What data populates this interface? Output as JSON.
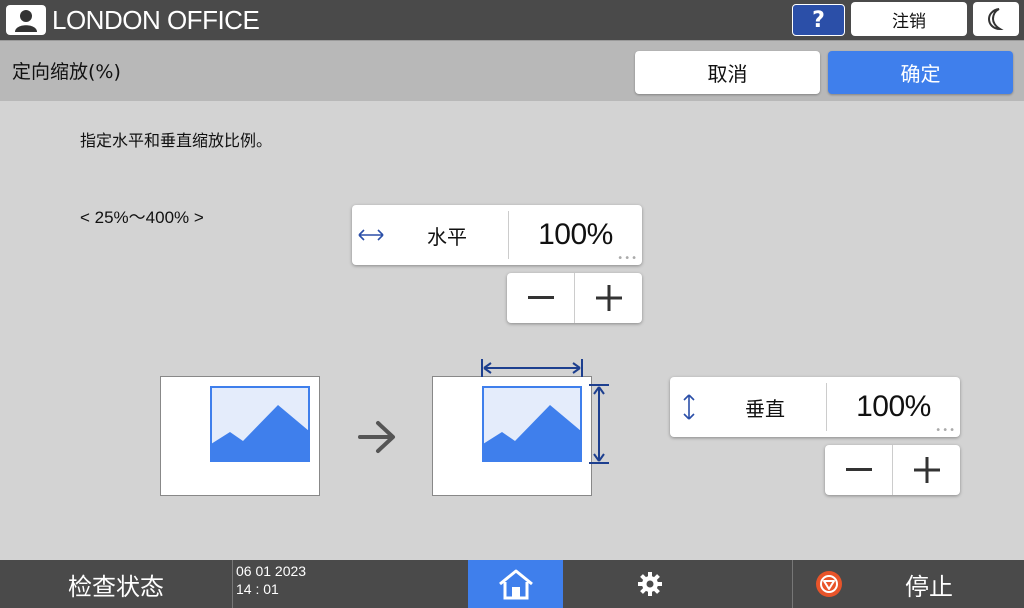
{
  "header": {
    "office_name": "LONDON OFFICE",
    "help_label": "?",
    "logout_label": "注销"
  },
  "titlebar": {
    "title": "定向缩放(%)",
    "cancel_label": "取消",
    "ok_label": "确定"
  },
  "main": {
    "instruction": "指定水平和垂直缩放比例。",
    "range": "< 25%〜400% >",
    "horizontal": {
      "icon": "horizontal-arrows-icon",
      "label": "水平",
      "value": "100%"
    },
    "vertical": {
      "icon": "vertical-arrows-icon",
      "label": "垂直",
      "value": "100%"
    }
  },
  "footer": {
    "status_label": "检查状态",
    "date": "06 01 2023",
    "time": "14 : 01",
    "stop_label": "停止"
  },
  "colors": {
    "accent": "#3f7fec",
    "dark_blue": "#2b4fa8",
    "bar_bg": "#4a4a4a",
    "stop_icon": "#e8542a"
  }
}
